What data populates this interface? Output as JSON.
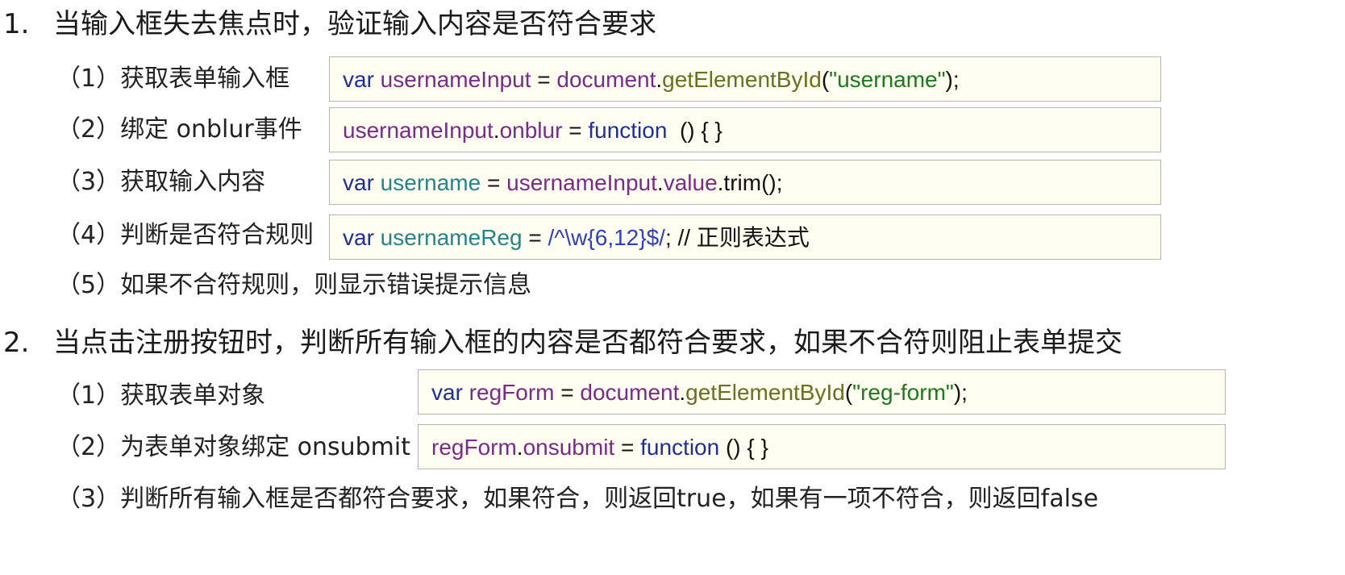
{
  "sections": [
    {
      "number": "1.",
      "title": "当输入框失去焦点时，验证输入内容是否符合要求",
      "steps": [
        {
          "label": "（1）获取表单输入框"
        },
        {
          "label": "（2）绑定 onblur事件"
        },
        {
          "label": "（3）获取输入内容"
        },
        {
          "label": "（4）判断是否符合规则"
        },
        {
          "label": "（5）如果不合符规则，则显示错误提示信息"
        }
      ]
    },
    {
      "number": "2.",
      "title": "当点击注册按钮时，判断所有输入框的内容是否都符合要求，如果不合符则阻止表单提交",
      "steps": [
        {
          "label": "（1）获取表单对象"
        },
        {
          "label": "（2）为表单对象绑定 onsubmit"
        },
        {
          "label": "（3）判断所有输入框是否都符合要求，如果符合，则返回true，如果有一项不符合，则返回false"
        }
      ]
    }
  ],
  "code": {
    "s1_1": {
      "t1": "var",
      "t2": " usernameInput",
      "t3": " = ",
      "t4": "document",
      "t5": ".",
      "t6": "getElementById",
      "t7": "(",
      "t8": "\"username\"",
      "t9": ");"
    },
    "s1_2": {
      "t1": "usernameInput",
      "t2": ".",
      "t3": "onblur",
      "t4": " = ",
      "t5": "function",
      "t6": "  () { }"
    },
    "s1_3": {
      "t1": "var",
      "t2": " username",
      "t3": " = ",
      "t4": "usernameInput",
      "t5": ".",
      "t6": "value",
      "t7": ".trim();"
    },
    "s1_4": {
      "t1": "var",
      "t2": " usernameReg",
      "t3": " = ",
      "t4": "/^\\w{6,12}$/",
      "t5": "; // 正则表达式"
    },
    "s2_1": {
      "t1": "var",
      "t2": " regForm",
      "t3": " = ",
      "t4": "document",
      "t5": ".",
      "t6": "getElementById",
      "t7": "(",
      "t8": "\"reg-form\"",
      "t9": ");"
    },
    "s2_2": {
      "t1": "regForm",
      "t2": ".",
      "t3": "onsubmit",
      "t4": " = ",
      "t5": "function",
      "t6": " () { }"
    }
  },
  "colors": {
    "keyword": "#1e2f9c",
    "variable": "#7a2a8a",
    "method": "#6b7021",
    "string": "#1b7a1b",
    "local_variable": "#25848a",
    "regex": "#2f40c0",
    "code_background": "#fffef0"
  }
}
